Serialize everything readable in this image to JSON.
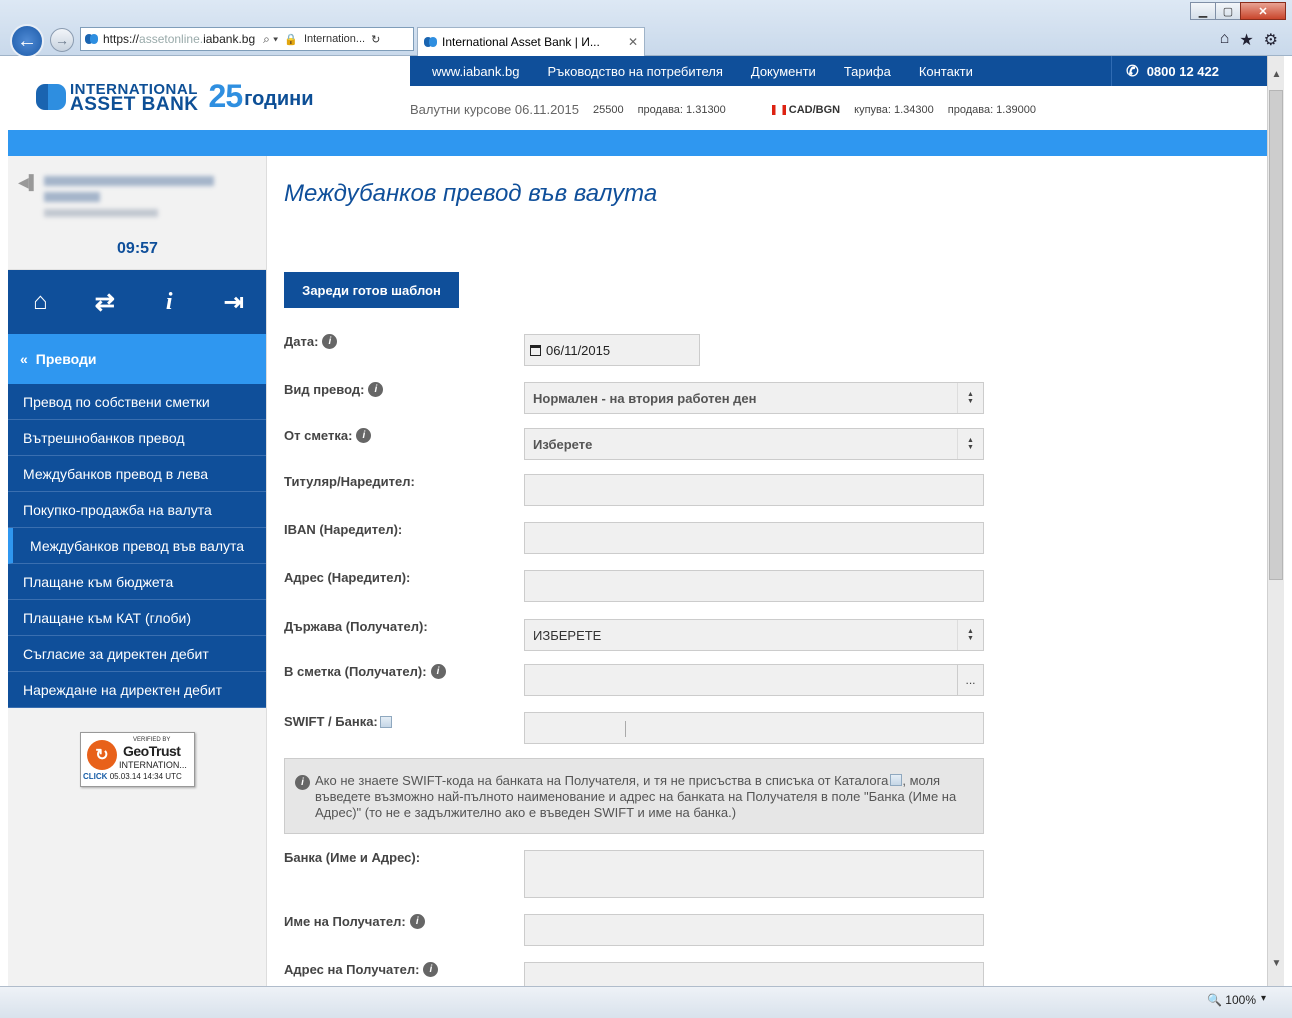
{
  "browser": {
    "url_prefix": "https://",
    "url_dim": "assetonline.",
    "url_host": "iabank.bg",
    "site_lock_label": "Internation...",
    "tab_title": "International Asset Bank | И...",
    "tab_close": "✕",
    "zoom": "100%"
  },
  "header": {
    "logo_line1": "INTERNATIONAL",
    "logo_line2": "ASSET BANK",
    "logo_25": "25",
    "logo_years": "години",
    "nav": [
      "www.iabank.bg",
      "Ръководство на потребителя",
      "Документи",
      "Тарифа",
      "Контакти"
    ],
    "phone": "0800 12 422",
    "rates_label": "Валутни курсове 06.11.2015",
    "rate_code": "25500",
    "rate_sell_1": "продава: 1.31300",
    "currency": "CAD/BGN",
    "rate_buy_2": "купува: 1.34300",
    "rate_sell_2": "продава: 1.39000"
  },
  "sidebar": {
    "time": "09:57",
    "section": "Преводи",
    "items": [
      "Превод по собствени сметки",
      "Вътрешнобанков превод",
      "Междубанков превод в лева",
      "Покупко-продажба на валута",
      "Междубанков превод във валута",
      "Плащане към бюджета",
      "Плащане към КАТ (глоби)",
      "Съгласие за директен дебит",
      "Нареждане на директен дебит"
    ],
    "badge": {
      "verified": "VERIFIED BY",
      "brand": "GeoTrust",
      "intl": "INTERNATION...",
      "click": "CLICK",
      "stamp": "05.03.14 14:34 UTC"
    }
  },
  "form": {
    "title": "Междубанков превод във валута",
    "template_button": "Зареди готов шаблон",
    "date_label": "Дата:",
    "date_value": "06/11/2015",
    "type_label": "Вид превод:",
    "type_value": "Нормален - на втория работен ден",
    "from_label": "От сметка:",
    "from_value": "Изберете",
    "holder_label": "Титуляр/Наредител:",
    "iban_label": "IBAN (Наредител):",
    "address_label": "Адрес (Наредител):",
    "country_label": "Държава (Получател):",
    "country_value": "ИЗБЕРЕТЕ",
    "to_account_label": "В сметка (Получател):",
    "dots": "...",
    "swift_label": "SWIFT / Банка:",
    "notice": "Ако не знаете SWIFT-кода на банката на Получателя, и тя не присъства в списъка от Каталога",
    "notice_rest": ", моля въведете възможно най-пълното наименование и адрес на банката на Получателя в поле \"Банка (Име на Адрес)\" (то не е задължително ако е въведен SWIFT и име на банка.)",
    "bank_label": "Банка (Име и Адрес):",
    "recipient_name_label": "Име на Получател:",
    "recipient_address_label": "Адрес на Получател:"
  }
}
